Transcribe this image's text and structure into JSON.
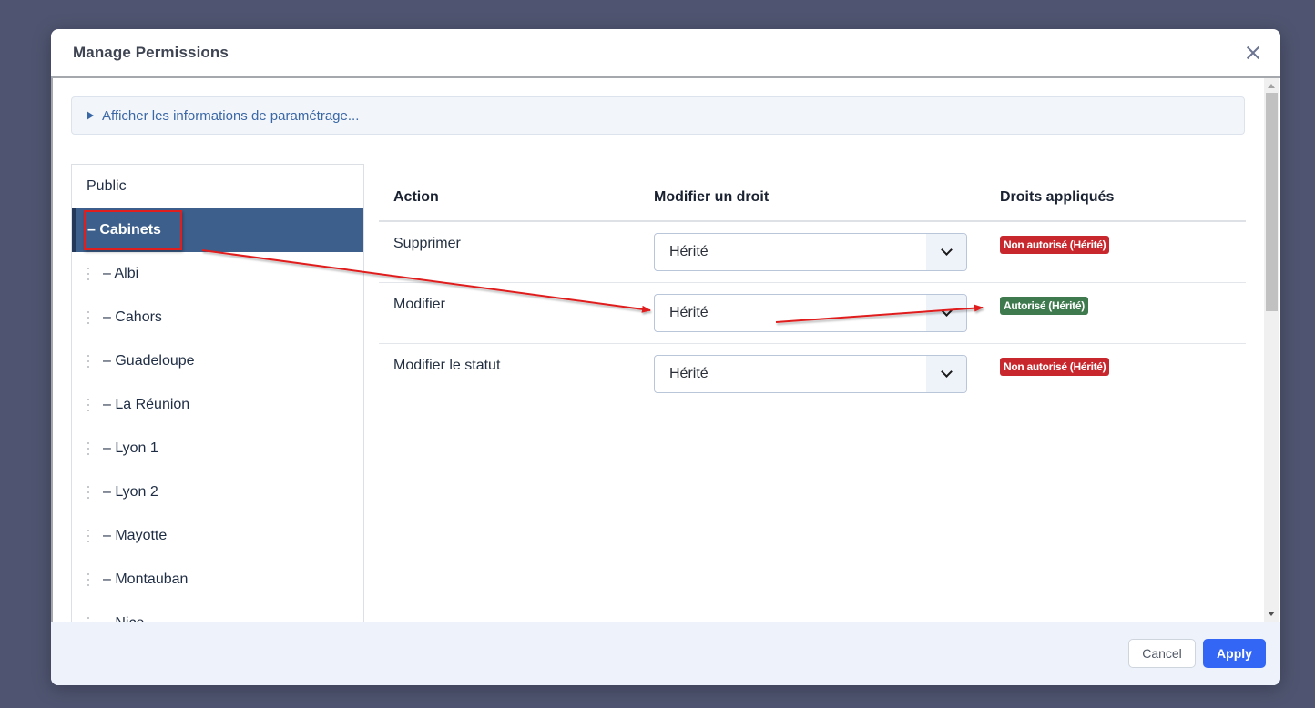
{
  "dialog": {
    "title": "Manage Permissions",
    "close_icon": "close-icon"
  },
  "info_toggle": {
    "label": "Afficher les informations de paramétrage...",
    "icon": "triangle-right-icon"
  },
  "tree": {
    "items": [
      {
        "label": "Public",
        "level": 0,
        "selected": false
      },
      {
        "label": "– Cabinets",
        "level": 0,
        "selected": true
      },
      {
        "label": "– Albi",
        "level": 1,
        "selected": false
      },
      {
        "label": "– Cahors",
        "level": 1,
        "selected": false
      },
      {
        "label": "– Guadeloupe",
        "level": 1,
        "selected": false
      },
      {
        "label": "– La Réunion",
        "level": 1,
        "selected": false
      },
      {
        "label": "– Lyon 1",
        "level": 1,
        "selected": false
      },
      {
        "label": "– Lyon 2",
        "level": 1,
        "selected": false
      },
      {
        "label": "– Mayotte",
        "level": 1,
        "selected": false
      },
      {
        "label": "– Montauban",
        "level": 1,
        "selected": false
      },
      {
        "label": "– Nice",
        "level": 1,
        "selected": false
      }
    ]
  },
  "permissions": {
    "headers": {
      "action": "Action",
      "modify": "Modifier un droit",
      "applied": "Droits appliqués"
    },
    "rows": [
      {
        "action": "Supprimer",
        "select_value": "Hérité",
        "applied": "Non autorisé (Hérité)",
        "status": "deny"
      },
      {
        "action": "Modifier",
        "select_value": "Hérité",
        "applied": "Autorisé (Hérité)",
        "status": "allow"
      },
      {
        "action": "Modifier le statut",
        "select_value": "Hérité",
        "applied": "Non autorisé (Hérité)",
        "status": "deny"
      }
    ]
  },
  "footer": {
    "cancel_label": "Cancel",
    "apply_label": "Apply"
  },
  "colors": {
    "accent": "#3366f5",
    "selected_row": "#3d5f8c",
    "deny": "#c8282d",
    "allow": "#3f7a4e",
    "annotation": "#e01e1e"
  }
}
